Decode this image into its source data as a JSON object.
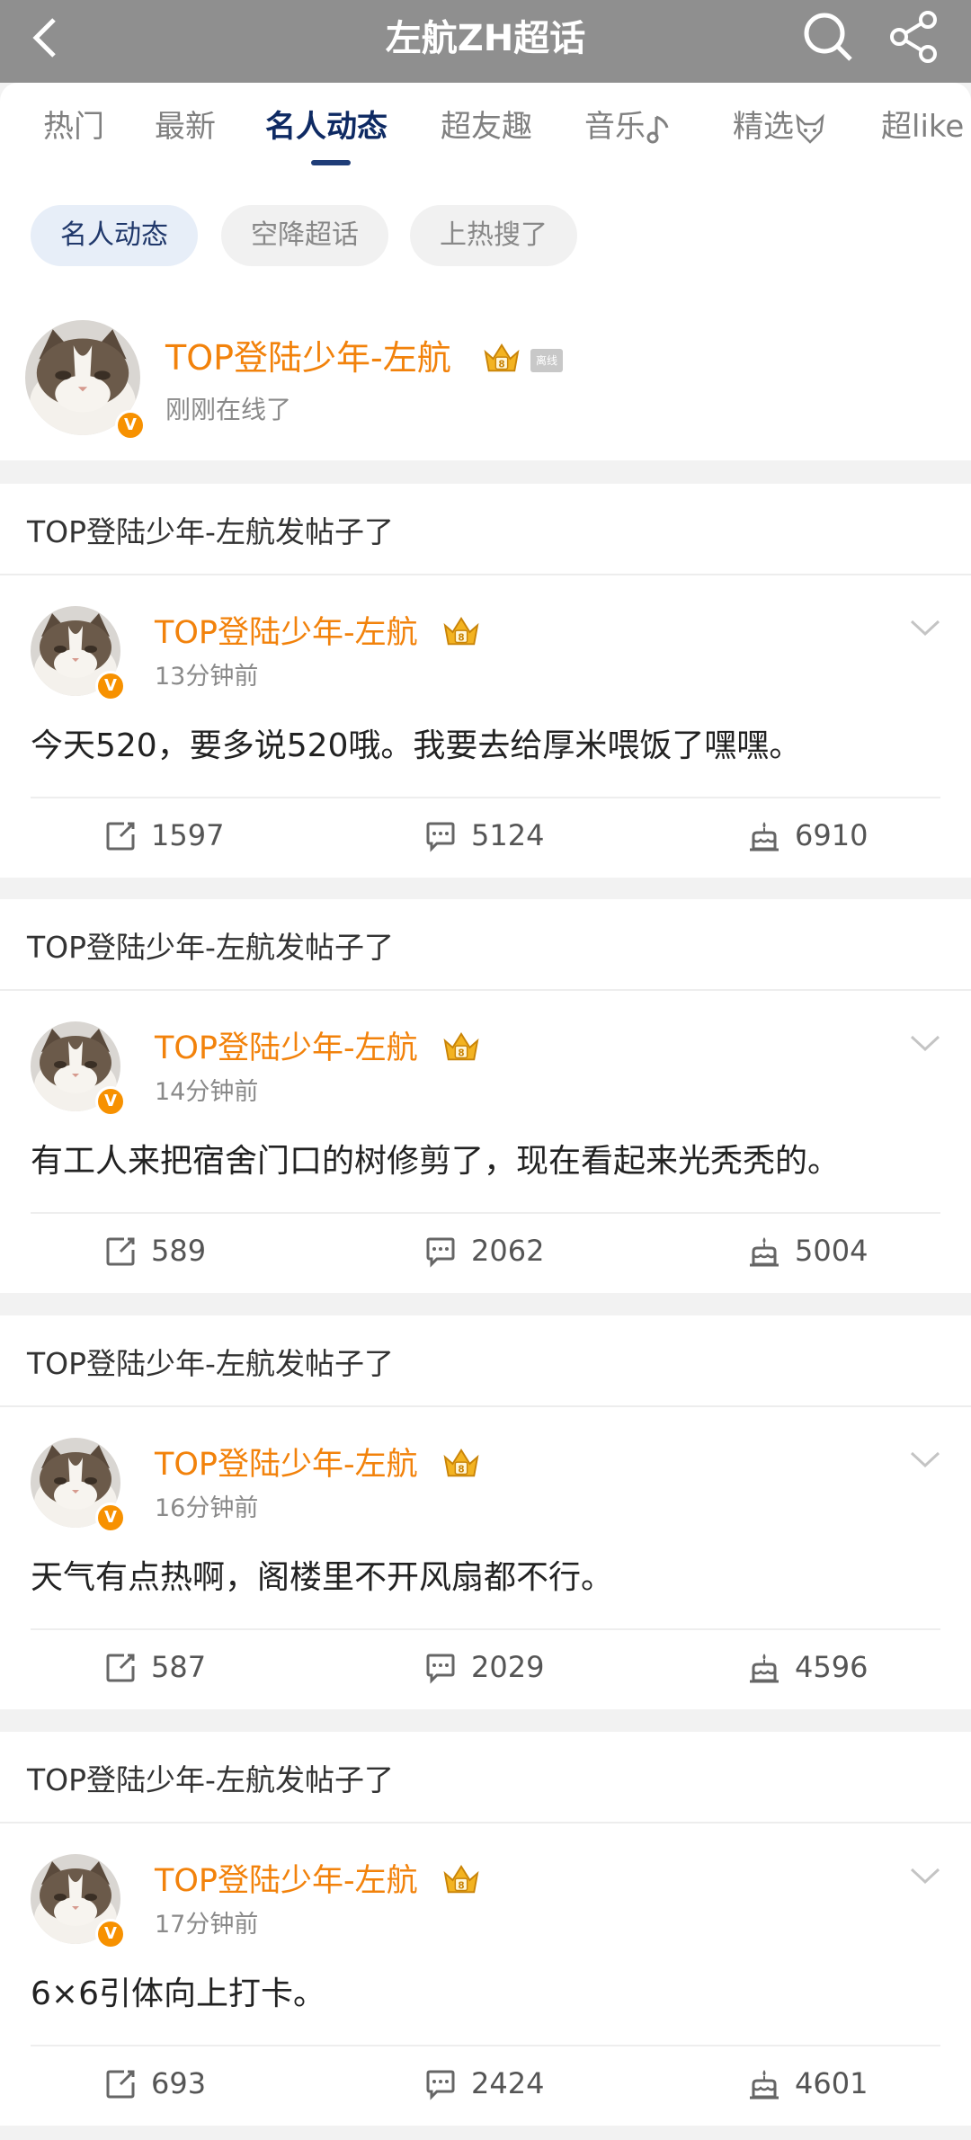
{
  "header": {
    "title": "左航ZH超话"
  },
  "tabs": [
    {
      "label": "热门"
    },
    {
      "label": "最新"
    },
    {
      "label": "名人动态"
    },
    {
      "label": "超友趣"
    },
    {
      "label": "音乐"
    },
    {
      "label": "精选"
    },
    {
      "label": "超like"
    }
  ],
  "chips": [
    {
      "label": "名人动态"
    },
    {
      "label": "空降超话"
    },
    {
      "label": "上热搜了"
    }
  ],
  "celebrity": {
    "name": "TOP登陆少年-左航",
    "status": "刚刚在线了",
    "offline_tag": "离线"
  },
  "posts": [
    {
      "section_title": "TOP登陆少年-左航发帖子了",
      "author": "TOP登陆少年-左航",
      "time": "13分钟前",
      "text": "今天520，要多说520哦。我要去给厚米喂饭了嘿嘿。",
      "reposts": "1597",
      "comments": "5124",
      "likes": "6910"
    },
    {
      "section_title": "TOP登陆少年-左航发帖子了",
      "author": "TOP登陆少年-左航",
      "time": "14分钟前",
      "text": "有工人来把宿舍门口的树修剪了，现在看起来光秃秃的。",
      "reposts": "589",
      "comments": "2062",
      "likes": "5004"
    },
    {
      "section_title": "TOP登陆少年-左航发帖子了",
      "author": "TOP登陆少年-左航",
      "time": "16分钟前",
      "text": "天气有点热啊，阁楼里不开风扇都不行。",
      "reposts": "587",
      "comments": "2029",
      "likes": "4596"
    },
    {
      "section_title": "TOP登陆少年-左航发帖子了",
      "author": "TOP登陆少年-左航",
      "time": "17分钟前",
      "text": "6×6引体向上打卡。",
      "reposts": "693",
      "comments": "2424",
      "likes": "4601"
    }
  ],
  "colors": {
    "header_bg": "#8f8f8f",
    "name_orange": "#f2820b",
    "tab_active": "#0e2a63",
    "badge_orange": "#f79100"
  },
  "icons": [
    "back-arrow-icon",
    "search-icon",
    "share-icon",
    "music-note-icon",
    "fox-icon",
    "crown-icon",
    "verified-badge-icon",
    "chevron-down-icon",
    "repost-icon",
    "comment-icon",
    "like-cake-icon"
  ]
}
